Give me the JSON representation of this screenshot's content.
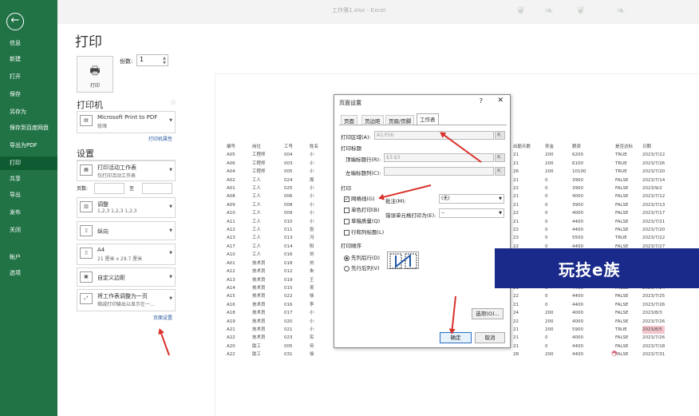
{
  "window": {
    "title": "工作簿1.xlsx - Excel"
  },
  "sidebar": {
    "back": "←",
    "items": [
      "信息",
      "新建",
      "打开",
      "保存",
      "另存为",
      "保存到百度网盘",
      "导出为PDF",
      "打印",
      "共享",
      "导出",
      "发布",
      "关闭",
      "帐户",
      "选项"
    ],
    "active_index": 7
  },
  "print": {
    "title": "打印",
    "print_button": "打印",
    "copies_label": "份数:",
    "copies_value": "1",
    "printer_section": "打印机",
    "printer_name": "Microsoft Print to PDF",
    "printer_status": "就绪",
    "printer_props": "打印机属性",
    "settings_section": "设置",
    "range_t1": "打印活动工作表",
    "range_t2": "仅打印活动工作表",
    "pages_label": "页数:",
    "pages_to": "至",
    "collate_t1": "调整",
    "collate_t2": "1,2,3    1,2,3    1,2,3",
    "orientation": "纵向",
    "paper_t1": "A4",
    "paper_t2": "21 厘米 x 29.7 厘米",
    "margins": "自定义边距",
    "scaling_t1": "将工作表调整为一页",
    "scaling_t2": "缩减打印输出以显示在一...",
    "page_setup_link": "页面设置"
  },
  "sheet": {
    "headers": [
      "编号",
      "岗位",
      "工号",
      "姓名"
    ],
    "rows": [
      [
        "A05",
        "工程师",
        "004",
        "小"
      ],
      [
        "A06",
        "工程师",
        "003",
        "小"
      ],
      [
        "A04",
        "工程师",
        "005",
        "小"
      ],
      [
        "A02",
        "工人",
        "024",
        "周"
      ],
      [
        "A01",
        "工人",
        "025",
        "小"
      ],
      [
        "A08",
        "工人",
        "006",
        "小"
      ],
      [
        "A09",
        "工人",
        "008",
        "小"
      ],
      [
        "A10",
        "工人",
        "009",
        "小"
      ],
      [
        "A11",
        "工人",
        "010",
        "小"
      ],
      [
        "A12",
        "工人",
        "011",
        "张"
      ],
      [
        "A13",
        "工人",
        "013",
        "冯"
      ],
      [
        "A17",
        "工人",
        "014",
        "阳"
      ],
      [
        "A10",
        "工人",
        "016",
        "刘"
      ],
      [
        "A01",
        "技术员",
        "018",
        "刘"
      ],
      [
        "A12",
        "技术员",
        "012",
        "朱"
      ],
      [
        "A13",
        "技术员",
        "019",
        "王"
      ],
      [
        "A14",
        "技术员",
        "015",
        "吴"
      ],
      [
        "A15",
        "技术员",
        "022",
        "徐"
      ],
      [
        "A16",
        "技术员",
        "016",
        "李"
      ],
      [
        "A18",
        "技术员",
        "017",
        "小"
      ],
      [
        "A19",
        "技术员",
        "020",
        "小"
      ],
      [
        "A21",
        "技术员",
        "021",
        "小"
      ],
      [
        "A22",
        "技术员",
        "023",
        "实"
      ],
      [
        "A20",
        "助工",
        "005",
        "何"
      ],
      [
        "A22",
        "助工",
        "031",
        "徐"
      ]
    ],
    "right_headers": [
      "出勤天数",
      "奖金",
      "薪资",
      "是否达标",
      "日期"
    ],
    "right_rows": [
      [
        "21",
        "200",
        "6200",
        "TRUE",
        "2023/7/22"
      ],
      [
        "21",
        "200",
        "6100",
        "TRUE",
        "2023/7/26"
      ],
      [
        "26",
        "200",
        "10100",
        "TRUE",
        "2023/7/20"
      ],
      [
        "21",
        "0",
        "3900",
        "FALSE",
        "2023/7/14"
      ],
      [
        "22",
        "0",
        "3900",
        "FALSE",
        "2023/9/2"
      ],
      [
        "21",
        "0",
        "4000",
        "FALSE",
        "2023/7/12"
      ],
      [
        "21",
        "0",
        "3900",
        "FALSE",
        "2023/7/13"
      ],
      [
        "22",
        "0",
        "4000",
        "FALSE",
        "2023/7/17"
      ],
      [
        "21",
        "0",
        "4400",
        "FALSE",
        "2023/7/21"
      ],
      [
        "22",
        "0",
        "4400",
        "FALSE",
        "2023/7/20"
      ],
      [
        "23",
        "0",
        "5500",
        "TRUE",
        "2023/7/22"
      ],
      [
        "22",
        "0",
        "4400",
        "FALSE",
        "2023/7/27"
      ],
      [
        "24",
        "200",
        "5400",
        "TRUE",
        "2023/8/4"
      ],
      [
        "21",
        "0",
        "4400",
        "FALSE",
        "2023/7/21"
      ],
      [
        "21",
        "0",
        "4400",
        "FALSE",
        "2023/7/22"
      ],
      [
        "21",
        "0",
        "4400",
        "FALSE",
        "2023/7/23"
      ],
      [
        "21",
        "0",
        "4400",
        "FALSE",
        "2023/7/24"
      ],
      [
        "22",
        "0",
        "4400",
        "FALSE",
        "2023/7/25"
      ],
      [
        "21",
        "0",
        "4400",
        "FALSE",
        "2023/7/26"
      ],
      [
        "24",
        "200",
        "4000",
        "FALSE",
        "2023/8/3"
      ],
      [
        "22",
        "200",
        "4000",
        "FALSE",
        "2023/7/26"
      ],
      [
        "21",
        "200",
        "5900",
        "TRUE",
        "2023/8/5"
      ],
      [
        "21",
        "0",
        "4000",
        "FALSE",
        "2023/7/26"
      ],
      [
        "21",
        "0",
        "4400",
        "FALSE",
        "2023/7/18"
      ],
      [
        "28",
        "200",
        "4400",
        "FALSE",
        "2023/7/31"
      ]
    ],
    "pink_rows": [
      12,
      21
    ]
  },
  "dialog": {
    "title": "页面设置",
    "help": "?",
    "close": "✕",
    "tabs": [
      "页面",
      "页边距",
      "页眉/页脚",
      "工作表"
    ],
    "active_tab": 3,
    "print_area_label": "打印区域(A):",
    "print_area_value": "A1:P26",
    "print_titles_label": "打印标题",
    "top_rows_label": "顶端标题行(R):",
    "top_rows_value": "$3:$3",
    "left_cols_label": "左端标题列(C):",
    "print_label": "打印",
    "gridlines": "网格线(G)",
    "blackwhite": "单色打印(B)",
    "draft": "草稿质量(Q)",
    "rowcol": "行和列标题(L)",
    "comments_label": "批注(M):",
    "comments_value": "(无)",
    "errors_label": "错误单元格打印为(E):",
    "errors_value": "--",
    "order_label": "打印顺序",
    "down_then_over": "先列后行(D)",
    "over_then_down": "先行后列(V)",
    "options_button": "选项(O)...",
    "ok_button": "确定",
    "cancel_button": "取消"
  },
  "banner": {
    "text": "玩技e族"
  },
  "colors": {
    "sidebar": "#217346",
    "sidebar_active": "#0f5c32",
    "arrow": "#d9302a",
    "banner": "#1a2a8a",
    "highlight": "#f4c6cc"
  }
}
